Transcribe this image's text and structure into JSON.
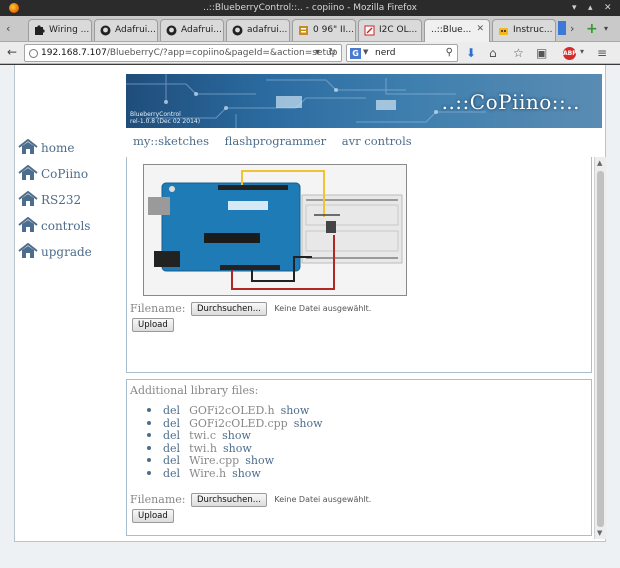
{
  "window": {
    "title": "..::BlueberryControl::.. - copiino - Mozilla Firefox"
  },
  "tabs": [
    {
      "label": "Wiring ...",
      "icon": "puzzle-icon",
      "active": false
    },
    {
      "label": "Adafrui...",
      "icon": "github-icon",
      "active": false
    },
    {
      "label": "Adafrui...",
      "icon": "github-icon",
      "active": false
    },
    {
      "label": "adafrui...",
      "icon": "github-icon",
      "active": false
    },
    {
      "label": "0 96\" II...",
      "icon": "page-icon",
      "active": false
    },
    {
      "label": "I2C OL...",
      "icon": "page-icon",
      "active": false
    },
    {
      "label": "..::Blue...",
      "icon": "page-icon",
      "active": true
    },
    {
      "label": "Instruc...",
      "icon": "robot-icon",
      "active": false
    }
  ],
  "navbar": {
    "url_host": "192.168.7.107",
    "url_path": "/BlueberryC/?app=copiino&pageId=&action=setup",
    "search_value": "nerd",
    "search_engine": "G",
    "abp_label": "ABP"
  },
  "banner": {
    "brand": "..::CoPiino::..",
    "sub_line1": "BlueberryControl",
    "sub_line2": "rel-1.0.8 (Dec 02 2014)"
  },
  "sidebar": {
    "items": [
      {
        "label": "home"
      },
      {
        "label": "CoPiino"
      },
      {
        "label": "RS232"
      },
      {
        "label": "controls"
      },
      {
        "label": "upgrade"
      }
    ]
  },
  "topnav": {
    "items": [
      {
        "label": "my::sketches"
      },
      {
        "label": "flashprogrammer"
      },
      {
        "label": "avr controls"
      }
    ]
  },
  "sketch_panel": {
    "filename_label": "Filename:",
    "browse_label": "Durchsuchen...",
    "no_file_label": "Keine Datei ausgewählt.",
    "upload_label": "Upload"
  },
  "library_panel": {
    "title": "Additional library files:",
    "files": [
      {
        "del": "del",
        "name": "GOFi2cOLED.h",
        "show": "show"
      },
      {
        "del": "del",
        "name": "GOFi2cOLED.cpp",
        "show": "show"
      },
      {
        "del": "del",
        "name": "twi.c",
        "show": "show"
      },
      {
        "del": "del",
        "name": "twi.h",
        "show": "show"
      },
      {
        "del": "del",
        "name": "Wire.cpp",
        "show": "show"
      },
      {
        "del": "del",
        "name": "Wire.h",
        "show": "show"
      }
    ],
    "filename_label": "Filename:",
    "browse_label": "Durchsuchen...",
    "no_file_label": "Keine Datei ausgewählt.",
    "upload_label": "Upload"
  },
  "colors": {
    "link": "#4d6d8c",
    "panel_border": "#a7bed1",
    "banner_blue": "#2b6ba0"
  }
}
